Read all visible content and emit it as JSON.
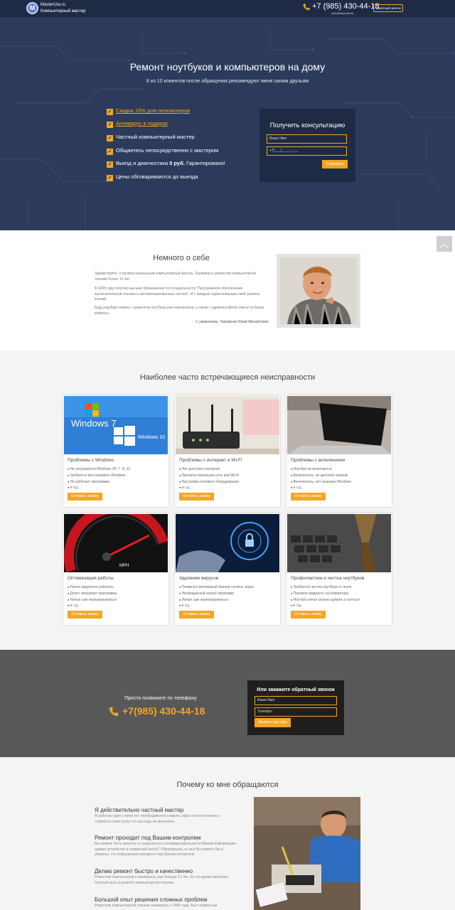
{
  "header": {
    "brand_line1": "MasterUra.ru",
    "brand_line2": "Компьютерный мастер",
    "logo_letter": "M",
    "phone": "+7 (985) 430-44-18",
    "phone_note": "(WhatsApp/Viber)",
    "callback_label": "обратный звонок"
  },
  "hero": {
    "title": "Ремонт ноутбуков и компьютеров на дому",
    "subtitle": "8 из 10 клиентов после обращения рекомендуют меня своим друзьям",
    "features": [
      {
        "text": "Скидка 10% для пенсионеров",
        "link": true
      },
      {
        "text": "Антивирус в подарок",
        "link": true
      },
      {
        "text": "Частный компьютерный мастер",
        "link": false
      },
      {
        "text": "Общаетесь непосредственно с мастером",
        "link": false
      },
      {
        "text_pre": "Выезд и диагностика ",
        "text_bold": "0 руб.",
        "text_post": " Гарантировано!",
        "link": false
      },
      {
        "text": "Цены обговариваются до выезда",
        "link": false
      }
    ],
    "form": {
      "title": "Получить консультацию",
      "name_placeholder": "Ваше Имя",
      "phone_placeholder": "+7(___)___-__-__",
      "submit": "Отправить"
    }
  },
  "about": {
    "title": "Немного о себе",
    "p1": "Здравствуйте, я профессиональный компьютерный мастер. Занимаюсь ремонтом компьютерной техники более 12 лет.",
    "p2": "В 2005 году получил высшее образование по специальности \"Программное обеспечение вычислительной техники и автоматизированных систем\". И с каждым годом повышаю свой уровень знаний.",
    "p3": "Буду рад Вам помочь с ремонтом ноутбука или компьютера, а также с удовольствием отвечу на Ваши вопросы.",
    "signature": "С уважением, Тимофеев Юрий Михайлович",
    "scroll_up": "︿"
  },
  "problems": {
    "title": "Наиболее часто встречающиеся неисправности",
    "button_label": "Оставить заявку",
    "cards": [
      {
        "title": "Проблемы с Windows",
        "items": [
          "Не загружается Windows XP, 7, 8, 10",
          "Требуется восстановить Windows",
          "Не работает программа",
          "и т.д..."
        ],
        "img": "windows",
        "img_text1": "Windows 7",
        "img_text2": "Windows 10"
      },
      {
        "title": "Проблемы с интернет и Wi-Fi",
        "items": [
          "Нет доступа к интернет",
          "Пропала локальная сеть или Wi-Fi",
          "Настройка сетевого оборудования",
          "и т.д..."
        ],
        "img": "router"
      },
      {
        "title": "Проблемы с включением",
        "items": [
          "Ноутбук не включается",
          "Включилось, но дисплей черный",
          "Включилось, нет загрузки Windows",
          "и т.д..."
        ],
        "img": "laptop"
      },
      {
        "title": "Оптимизация работы",
        "items": [
          "Начал медленно работать",
          "Долго загружает программы",
          "Начал сам перезагружаться",
          "и т.д..."
        ],
        "img": "speedometer",
        "img_text1": "MPH"
      },
      {
        "title": "Удаление вирусов",
        "items": [
          "Появился рекламный баннер на весь экран",
          "Неожиданный запуск программ",
          "Начал сам перезагружаться",
          "и т.д..."
        ],
        "img": "virus"
      },
      {
        "title": "Профилактика и чистка ноутбуков",
        "items": [
          "Требуется чистка ноутбука от пыли",
          "Пролили жидкость на клавиатуру",
          "Ноутбук начал сильно шуметь и греться",
          "и т.д..."
        ],
        "img": "keyboard"
      }
    ]
  },
  "call": {
    "label": "Просто позвоните по телефону",
    "phone": "+7(985) 430-44-18",
    "form_title": "Или закажите обратный звонок",
    "name_placeholder": "Ваше Имя",
    "phone_placeholder": "Телефон",
    "submit": "Вызвать мастера"
  },
  "why": {
    "title": "Почему ко мне обращаются",
    "items": [
      {
        "h": "Я действительно частный мастер",
        "p": "Я работаю один у меня нет необходимости снимать офис соответственно и стоимость моих услуг это расходы не включены."
      },
      {
        "h": "Ремонт проходит под Вашим контролем",
        "p": "Вы можете быть уверены в сохранности и конфиденциальности Вашей информации, сдавая устройство в сервисный центр? Обратившись ко мне Вы можете быть уверены, что информация находится под Вашим контролем."
      },
      {
        "h": "Делаю ремонт быстро и качественно",
        "p": "Ремонтом компьютеров я занимаюсь уже больше 12 лет. За это время приобрел богатый опыт в ремонте компьютерной техники."
      },
      {
        "h": "Большой опыт решения сложных проблем",
        "p": "Ремонтом компьютерной техники занимаюсь с 2006 года. Был сервисным"
      }
    ]
  },
  "colors": {
    "accent": "#f5a623",
    "header_bg": "#1f2b45",
    "hero_bg": "#2c3b5c",
    "band_bg": "#585858"
  }
}
